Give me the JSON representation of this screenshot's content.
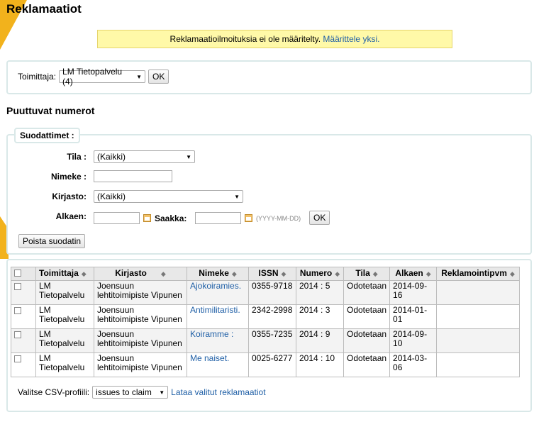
{
  "page_title": "Reklamaatiot",
  "notice": {
    "text": "Reklamaatioilmoituksia ei ole määritelty.",
    "link": "Määrittele yksi."
  },
  "supplier": {
    "label": "Toimittaja:",
    "selected": "LM Tietopalvelu (4)",
    "ok_label": "OK"
  },
  "section_title": "Puuttuvat numerot",
  "filters": {
    "legend": "Suodattimet :",
    "tila_label": "Tila :",
    "tila_value": "(Kaikki)",
    "nimeke_label": "Nimeke :",
    "nimeke_value": "",
    "kirjasto_label": "Kirjasto:",
    "kirjasto_value": "(Kaikki)",
    "alkaen_label": "Alkaen:",
    "saakka_label": "Saakka:",
    "date_hint": "(YYYY-MM-DD)",
    "ok_label": "OK",
    "clear_label": "Poista suodatin"
  },
  "table": {
    "headers": [
      "Toimittaja",
      "Kirjasto",
      "Nimeke",
      "ISSN",
      "Numero",
      "Tila",
      "Alkaen",
      "Reklamointipvm"
    ],
    "rows": [
      {
        "toimittaja": "LM Tietopalvelu",
        "kirjasto": "Joensuun lehtitoimipiste Vipunen",
        "nimeke": "Ajokoiramies.",
        "issn": "0355-9718",
        "numero": "2014 : 5",
        "tila": "Odotetaan",
        "alkaen": "2014-09-16",
        "reklamointipvm": ""
      },
      {
        "toimittaja": "LM Tietopalvelu",
        "kirjasto": "Joensuun lehtitoimipiste Vipunen",
        "nimeke": "Antimilitaristi.",
        "issn": "2342-2998",
        "numero": "2014 : 3",
        "tila": "Odotetaan",
        "alkaen": "2014-01-01",
        "reklamointipvm": ""
      },
      {
        "toimittaja": "LM Tietopalvelu",
        "kirjasto": "Joensuun lehtitoimipiste Vipunen",
        "nimeke": "Koiramme :",
        "issn": "0355-7235",
        "numero": "2014 : 9",
        "tila": "Odotetaan",
        "alkaen": "2014-09-10",
        "reklamointipvm": ""
      },
      {
        "toimittaja": "LM Tietopalvelu",
        "kirjasto": "Joensuun lehtitoimipiste Vipunen",
        "nimeke": "Me naiset.",
        "issn": "0025-6277",
        "numero": "2014 : 10",
        "tila": "Odotetaan",
        "alkaen": "2014-03-06",
        "reklamointipvm": ""
      }
    ]
  },
  "csv": {
    "label": "Valitse CSV-profiili:",
    "selected": "issues to claim",
    "action_link": "Lataa valitut reklamaatiot"
  },
  "colors": {
    "accent": "#f2b21c",
    "notice_bg": "#fff9a8",
    "link": "#1f5fa6",
    "box_border": "#d9e8e8"
  }
}
